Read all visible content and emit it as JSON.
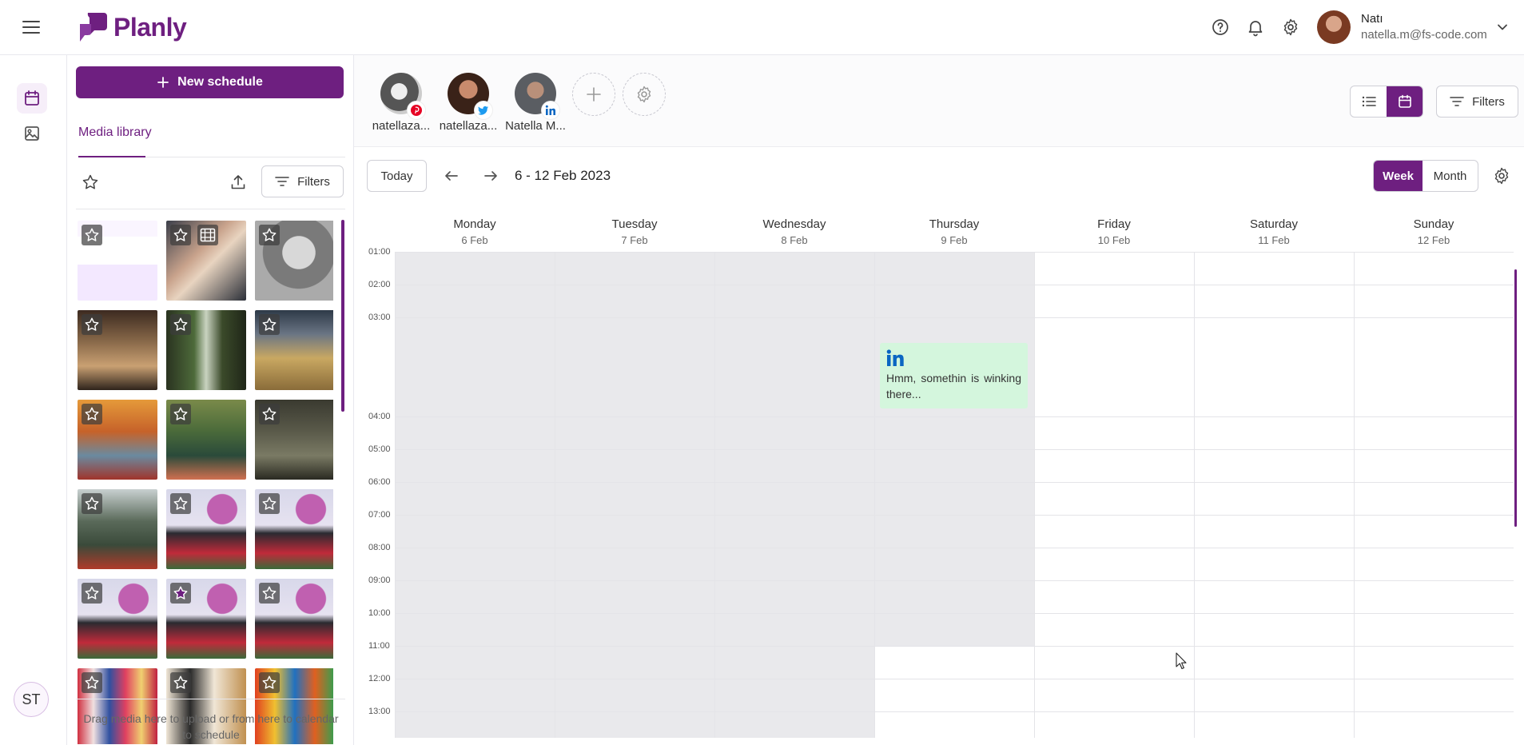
{
  "app": {
    "name": "Planly",
    "brand_color": "#6e1f80"
  },
  "header": {
    "help_icon": "help-circle-icon",
    "notifications_icon": "bell-icon",
    "settings_icon": "gear-icon",
    "user": {
      "name": "Natı",
      "email": "natella.m@fs-code.com"
    }
  },
  "rail": {
    "items": [
      {
        "name": "calendar",
        "icon": "calendar-icon",
        "active": true
      },
      {
        "name": "media",
        "icon": "image-icon",
        "active": false
      }
    ],
    "avatar_initials": "ST"
  },
  "media_panel": {
    "new_schedule_label": "New schedule",
    "tab_label": "Media library",
    "filters_label": "Filters",
    "drop_hint": "Drag media here to upload or from here to calendar to schedule",
    "items": [
      {
        "kind": "image",
        "starred": false,
        "theme": "pricing-screens"
      },
      {
        "kind": "video",
        "starred": false,
        "theme": "event-photo"
      },
      {
        "kind": "image",
        "starred": false,
        "theme": "bw-portrait"
      },
      {
        "kind": "image",
        "starred": false,
        "theme": "cafe-interior"
      },
      {
        "kind": "image",
        "starred": false,
        "theme": "window-plants"
      },
      {
        "kind": "image",
        "starred": false,
        "theme": "dried-flowers"
      },
      {
        "kind": "image",
        "starred": false,
        "theme": "autumn-kayak"
      },
      {
        "kind": "image",
        "starred": false,
        "theme": "lily-pads"
      },
      {
        "kind": "image",
        "starred": false,
        "theme": "cave-boat"
      },
      {
        "kind": "image",
        "starred": false,
        "theme": "river-boat"
      },
      {
        "kind": "image",
        "starred": false,
        "theme": "dance-painting"
      },
      {
        "kind": "image",
        "starred": false,
        "theme": "dance-painting"
      },
      {
        "kind": "image",
        "starred": false,
        "theme": "dance-painting"
      },
      {
        "kind": "image",
        "starred": true,
        "theme": "dance-painting"
      },
      {
        "kind": "image",
        "starred": false,
        "theme": "dance-painting"
      },
      {
        "kind": "image",
        "starred": false,
        "theme": "flower-field"
      },
      {
        "kind": "image",
        "starred": false,
        "theme": "illustration"
      },
      {
        "kind": "image",
        "starred": false,
        "theme": "colorful-market"
      }
    ]
  },
  "accounts": [
    {
      "name": "natellaza...",
      "network": "pinterest",
      "badge_color": "#e60023"
    },
    {
      "name": "natellaza...",
      "network": "twitter",
      "badge_color": "#1d9bf0"
    },
    {
      "name": "Natella M...",
      "network": "linkedin",
      "badge_color": "#0a66c2"
    }
  ],
  "calendar": {
    "today_label": "Today",
    "date_range": "6 - 12 Feb 2023",
    "filters_label": "Filters",
    "week_label": "Week",
    "month_label": "Month",
    "days": [
      {
        "name": "Monday",
        "date": "6 Feb"
      },
      {
        "name": "Tuesday",
        "date": "7 Feb"
      },
      {
        "name": "Wednesday",
        "date": "8 Feb"
      },
      {
        "name": "Thursday",
        "date": "9 Feb"
      },
      {
        "name": "Friday",
        "date": "10 Feb"
      },
      {
        "name": "Saturday",
        "date": "11 Feb"
      },
      {
        "name": "Sunday",
        "date": "12 Feb"
      }
    ],
    "hours": [
      "01:00",
      "02:00",
      "03:00",
      "04:00",
      "05:00",
      "06:00",
      "07:00",
      "08:00",
      "09:00",
      "10:00",
      "11:00",
      "12:00",
      "13:00"
    ],
    "post": {
      "day": "Thursday",
      "network": "linkedin",
      "text": "Hmm, somethin is winking there..."
    }
  }
}
